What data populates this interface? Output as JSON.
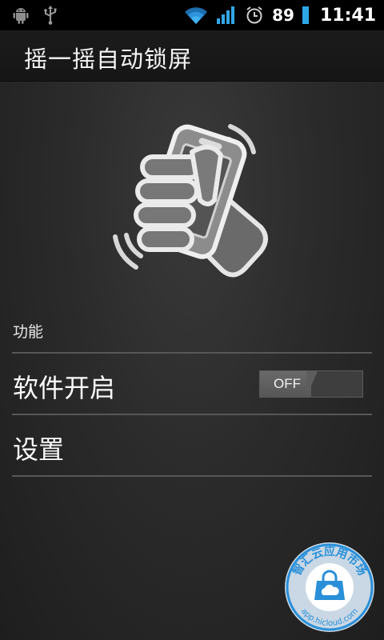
{
  "status_bar": {
    "icons_left": [
      "android-icon",
      "usb-icon"
    ],
    "icons_right": [
      "wifi-icon",
      "signal-icon",
      "alarm-icon",
      "battery-icon"
    ],
    "battery_level": "89",
    "time": "11:41"
  },
  "action_bar": {
    "title": "摇一摇自动锁屏"
  },
  "hero": {
    "icon": "shake-phone-hand-icon"
  },
  "section": {
    "title": "功能"
  },
  "rows": [
    {
      "label": "软件开启",
      "control": "toggle",
      "toggle_text": "OFF"
    },
    {
      "label": "设置"
    }
  ],
  "watermark": {
    "top_text": "智汇云应用市场",
    "bottom_text": "app.hicloud.com",
    "icon": "cloud-bag-icon",
    "color": "#2a8fd8"
  }
}
